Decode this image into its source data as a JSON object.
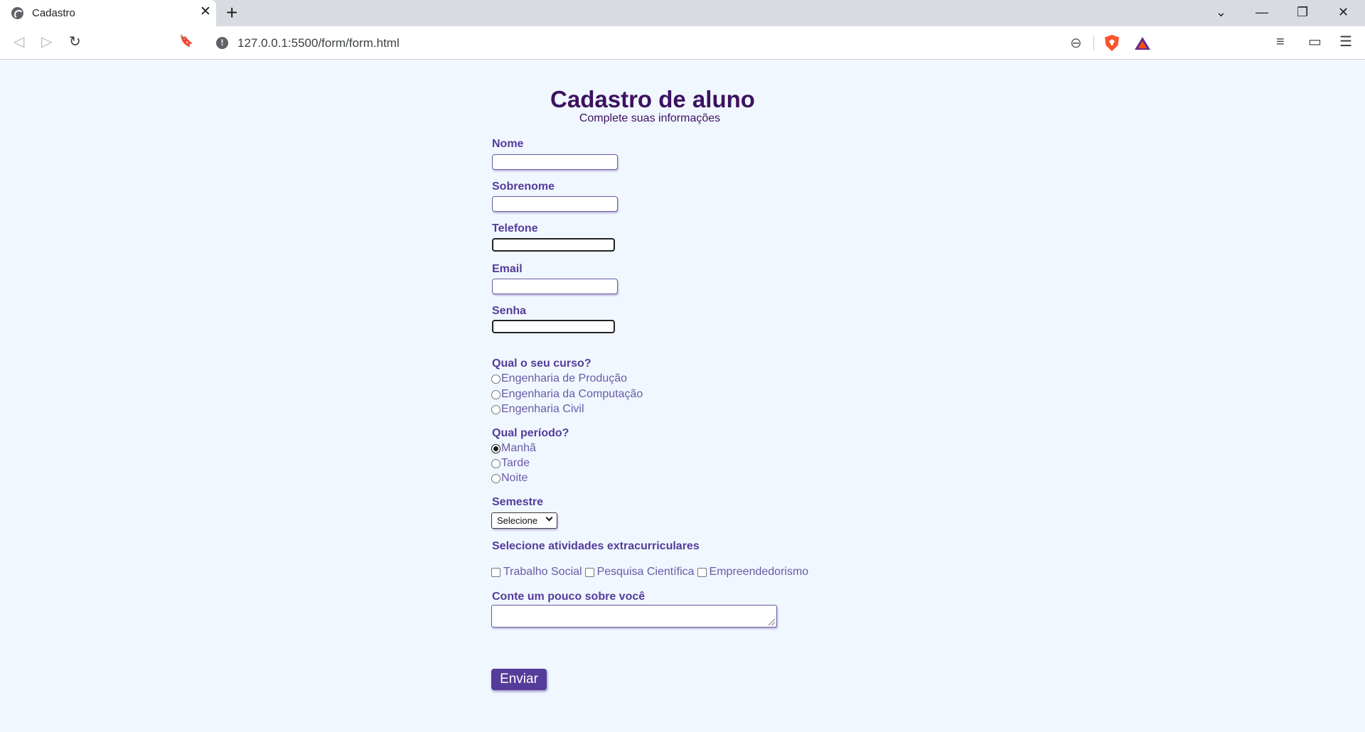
{
  "browser": {
    "tab_title": "Cadastro",
    "url": "127.0.0.1:5500/form/form.html",
    "icons": {
      "favicon": "globe-icon",
      "tab_close": "close-icon",
      "new_tab": "plus-icon",
      "tab_search": "chevron-down-icon",
      "minimize": "minimize-icon",
      "restore": "restore-icon",
      "window_close": "close-icon",
      "back": "back-arrow-icon",
      "forward": "forward-arrow-icon",
      "reload": "reload-icon",
      "bookmark": "bookmark-icon",
      "site_info": "info-icon",
      "zoom": "zoom-out-icon",
      "shields": "brave-shield-icon",
      "rewards": "brave-rewards-icon",
      "playlist": "playlist-icon",
      "wallet": "wallet-icon",
      "menu": "hamburger-menu-icon"
    },
    "glyphs": {
      "tab_close": "✕",
      "new_tab": "+",
      "tab_search": "⌄",
      "minimize": "—",
      "restore": "❐",
      "window_close": "✕",
      "back": "◁",
      "forward": "▷",
      "reload": "↻",
      "bookmark": "🔖",
      "site_info": "!",
      "zoom": "⊖",
      "playlist": "≡",
      "wallet": "▭",
      "menu": "☰"
    }
  },
  "form": {
    "title": "Cadastro de aluno",
    "subtitle": "Complete suas informações",
    "fields": {
      "nome": {
        "label": "Nome",
        "value": ""
      },
      "sobrenome": {
        "label": "Sobrenome",
        "value": ""
      },
      "telefone": {
        "label": "Telefone",
        "value": ""
      },
      "email": {
        "label": "Email",
        "value": ""
      },
      "senha": {
        "label": "Senha",
        "value": ""
      }
    },
    "curso": {
      "question": "Qual o seu curso?",
      "options": [
        "Engenharia de Produção",
        "Engenharia da Computação",
        "Engenharia Civil"
      ],
      "selected": null
    },
    "periodo": {
      "question": "Qual período?",
      "options": [
        "Manhã",
        "Tarde",
        "Noite"
      ],
      "selected": "Manhã"
    },
    "semestre": {
      "label": "Semestre",
      "selected": "Selecione"
    },
    "atividades": {
      "label": "Selecione atividades extracurriculares",
      "options": [
        "Trabalho Social",
        "Pesquisa Científica",
        "Empreendedorismo"
      ]
    },
    "sobre": {
      "label": "Conte um pouco sobre você",
      "value": ""
    },
    "submit_label": "Enviar"
  },
  "colors": {
    "page_background": "#f0f7ff",
    "title": "#3d1160",
    "label": "#553c9a",
    "button": "#553c9a"
  }
}
